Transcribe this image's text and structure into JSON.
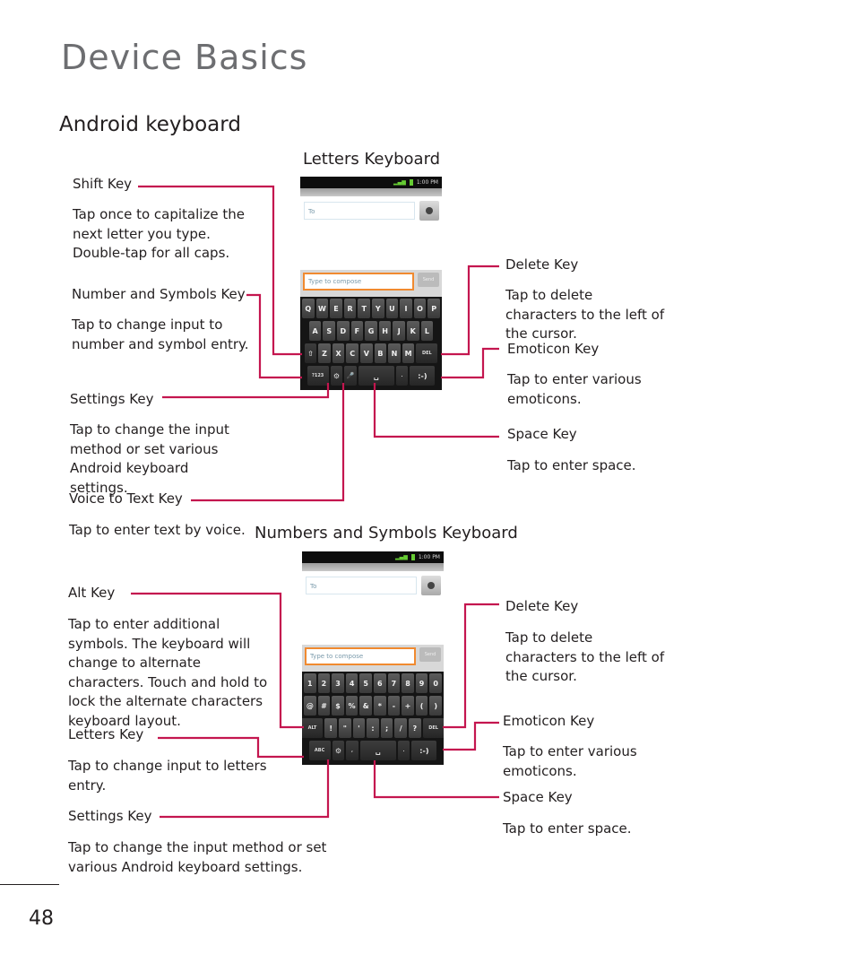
{
  "page": {
    "title": "Device Basics",
    "section_title": "Android keyboard",
    "page_number": "48"
  },
  "letters_keyboard": {
    "title": "Letters Keyboard",
    "screen": {
      "status_time": "1:00 PM",
      "to_placeholder": "To",
      "compose_placeholder": "Type to compose",
      "send_label": "Send",
      "rows": [
        [
          "Q",
          "W",
          "E",
          "R",
          "T",
          "Y",
          "U",
          "I",
          "O",
          "P"
        ],
        [
          "A",
          "S",
          "D",
          "F",
          "G",
          "H",
          "J",
          "K",
          "L"
        ],
        [
          "⇧",
          "Z",
          "X",
          "C",
          "V",
          "B",
          "N",
          "M",
          "DEL"
        ],
        [
          "?123",
          "⚙",
          "🎤",
          "␣",
          ".",
          ":-)"
        ]
      ]
    },
    "callouts": [
      {
        "id": "shift",
        "label": "Shift Key",
        "desc": "Tap once to capitalize the next letter you type. Double-tap for all caps."
      },
      {
        "id": "numsym",
        "label": "Number and Symbols Key",
        "desc": "Tap to change input to number and symbol entry."
      },
      {
        "id": "settings",
        "label": "Settings Key",
        "desc": "Tap to change the input method or set various Android keyboard settings."
      },
      {
        "id": "voice",
        "label": "Voice to Text Key",
        "desc": "Tap to enter text by voice."
      },
      {
        "id": "delete",
        "label": "Delete Key",
        "desc": "Tap to delete characters to the left of the cursor."
      },
      {
        "id": "emoticon",
        "label": "Emoticon Key",
        "desc": "Tap to enter various emoticons."
      },
      {
        "id": "space",
        "label": "Space Key",
        "desc": "Tap to enter space."
      }
    ]
  },
  "numbers_keyboard": {
    "title": "Numbers and Symbols Keyboard",
    "screen": {
      "status_time": "1:00 PM",
      "to_placeholder": "To",
      "compose_placeholder": "Type to compose",
      "send_label": "Send",
      "rows": [
        [
          "1",
          "2",
          "3",
          "4",
          "5",
          "6",
          "7",
          "8",
          "9",
          "0"
        ],
        [
          "@",
          "#",
          "$",
          "%",
          "&",
          "*",
          "-",
          "+",
          "(",
          ")"
        ],
        [
          "ALT",
          "!",
          "\"",
          "'",
          ":",
          ";",
          "/",
          "?",
          "DEL"
        ],
        [
          "ABC",
          "⚙",
          ",",
          "␣",
          ".",
          ":-)"
        ]
      ]
    },
    "callouts": [
      {
        "id": "alt",
        "label": "Alt Key",
        "desc": "Tap to enter additional symbols. The keyboard will change to alternate characters. Touch and hold to lock the alternate characters keyboard layout."
      },
      {
        "id": "letters",
        "label": "Letters Key",
        "desc": "Tap to change input to letters entry."
      },
      {
        "id": "settings",
        "label": "Settings Key",
        "desc": "Tap to change the input method or set various Android keyboard settings."
      },
      {
        "id": "delete",
        "label": "Delete Key",
        "desc": "Tap to delete characters to the left of the cursor."
      },
      {
        "id": "emoticon",
        "label": "Emoticon Key",
        "desc": "Tap to enter various emoticons."
      },
      {
        "id": "space",
        "label": "Space Key",
        "desc": "Tap to enter space."
      }
    ]
  },
  "colors": {
    "callout_line": "#c4164f",
    "title_gray": "#6d6e71",
    "text": "#231f20"
  }
}
